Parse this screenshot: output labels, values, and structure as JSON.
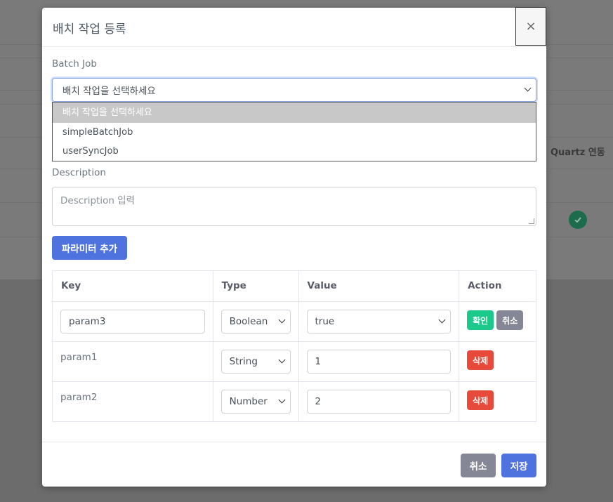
{
  "background": {
    "column_header": "Quartz 연동"
  },
  "modal": {
    "title": "배치 작업 등록",
    "close_glyph": "×",
    "batch_job": {
      "label": "Batch Job",
      "selected": "배치 작업을 선택하세요",
      "options": [
        "배치 작업을 선택하세요",
        "simpleBatchJob",
        "userSyncJob"
      ]
    },
    "description": {
      "label": "Description",
      "placeholder": "Description 입력"
    },
    "add_param_label": "파라미터 추가",
    "params_table": {
      "headers": [
        "Key",
        "Type",
        "Value",
        "Action"
      ],
      "editing_row": {
        "key": "param3",
        "type": "Boolean",
        "value": "true",
        "confirm_label": "확인",
        "cancel_label": "취소"
      },
      "rows": [
        {
          "key": "param1",
          "type": "String",
          "value": "1",
          "delete_label": "삭제"
        },
        {
          "key": "param2",
          "type": "Number",
          "value": "2",
          "delete_label": "삭제"
        }
      ]
    },
    "footer": {
      "cancel_label": "취소",
      "save_label": "저장"
    }
  },
  "colors": {
    "primary": "#4e73df",
    "success": "#1cc88a",
    "secondary": "#858796",
    "danger": "#e74a3b"
  }
}
